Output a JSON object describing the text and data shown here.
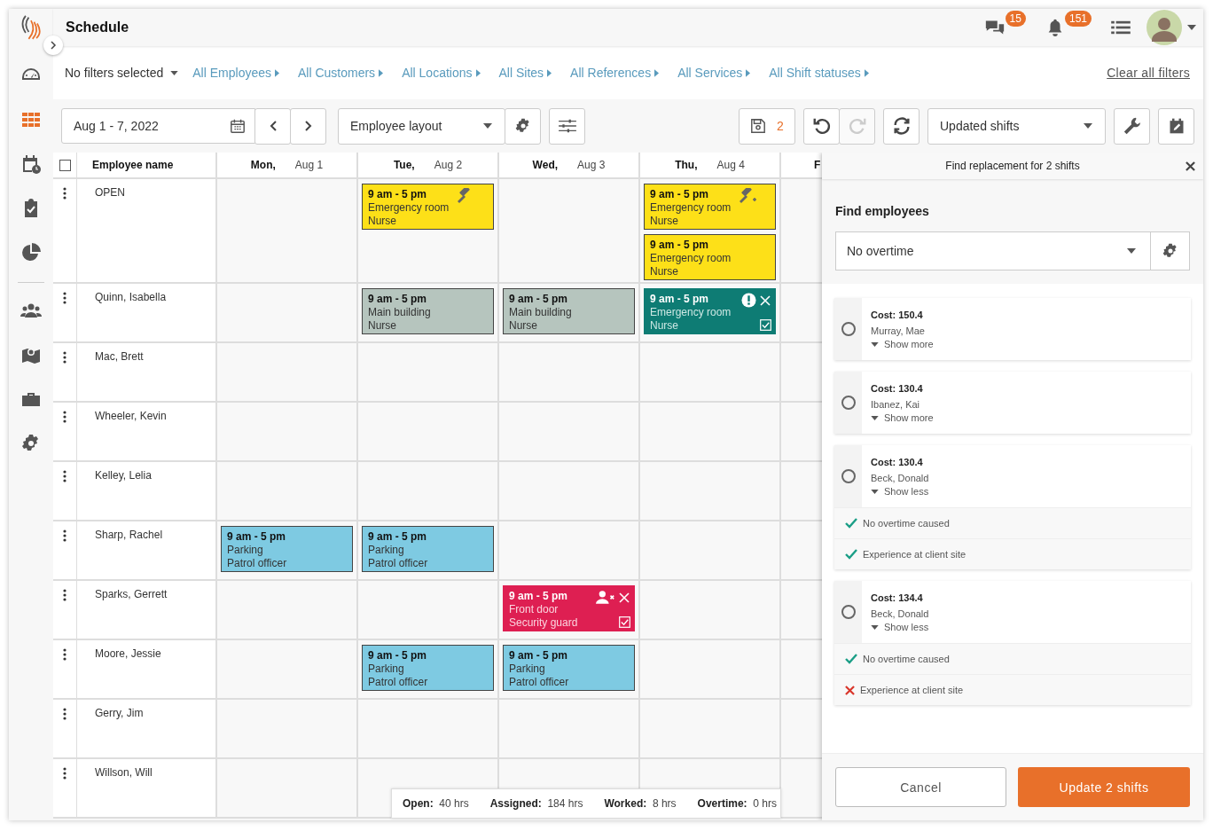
{
  "header": {
    "title": "Schedule",
    "messages_badge": "15",
    "notifications_badge": "151"
  },
  "sidebar": {
    "items": [
      {
        "selected": false
      },
      {
        "selected": true
      },
      {
        "selected": false
      },
      {
        "selected": false
      },
      {
        "selected": false
      },
      {
        "selected": false
      },
      {
        "selected": false
      },
      {
        "selected": false
      },
      {
        "selected": false
      }
    ]
  },
  "filters": {
    "preset": "No filters selected",
    "items": [
      "All Employees",
      "All Customers",
      "All Locations",
      "All Sites",
      "All References",
      "All Services",
      "All Shift statuses"
    ],
    "clear": "Clear all filters"
  },
  "toolbar": {
    "date_range": "Aug 1 - 7, 2022",
    "layout": "Employee layout",
    "unsaved_count": "2",
    "redo_disabled": true,
    "view": "Updated shifts"
  },
  "grid": {
    "select_all_checked": false,
    "name_header": "Employee name",
    "days": [
      {
        "day": "Mon,",
        "date": "Aug 1"
      },
      {
        "day": "Tue,",
        "date": "Aug 2"
      },
      {
        "day": "Wed,",
        "date": "Aug 3"
      },
      {
        "day": "Thu,",
        "date": "Aug 4"
      },
      {
        "day": "F"
      }
    ],
    "rows": [
      {
        "name": "OPEN",
        "cells": [
          [],
          [
            {
              "kind": "open-auction",
              "time": "9 am - 5 pm",
              "location": "Emergency room",
              "role": "Nurse"
            }
          ],
          [],
          [
            {
              "kind": "open-auction-more",
              "time": "9 am - 5 pm",
              "location": "Emergency room",
              "role": "Nurse"
            },
            {
              "kind": "open",
              "time": "9 am - 5 pm",
              "location": "Emergency room",
              "role": "Nurse"
            }
          ]
        ]
      },
      {
        "name": "Quinn, Isabella",
        "cells": [
          [],
          [
            {
              "kind": "assigned",
              "time": "9 am - 5 pm",
              "location": "Main building",
              "role": "Nurse"
            }
          ],
          [
            {
              "kind": "assigned",
              "time": "9 am - 5 pm",
              "location": "Main building",
              "role": "Nurse"
            }
          ],
          [
            {
              "kind": "conflict",
              "time": "9 am - 5 pm",
              "location": "Emergency room",
              "role": "Nurse",
              "checked": true
            }
          ]
        ]
      },
      {
        "name": "Mac, Brett",
        "cells": []
      },
      {
        "name": "Wheeler, Kevin",
        "cells": []
      },
      {
        "name": "Kelley, Lelia",
        "cells": []
      },
      {
        "name": "Sharp, Rachel",
        "cells": [
          [
            {
              "kind": "published",
              "time": "9 am - 5 pm",
              "location": "Parking",
              "role": "Patrol officer"
            }
          ],
          [
            {
              "kind": "published",
              "time": "9 am - 5 pm",
              "location": "Parking",
              "role": "Patrol officer"
            }
          ]
        ]
      },
      {
        "name": "Sparks, Gerrett",
        "cells": [
          [],
          [],
          [
            {
              "kind": "unassigned",
              "time": "9 am - 5 pm",
              "location": "Front door",
              "role": "Security guard",
              "checked": true
            }
          ]
        ]
      },
      {
        "name": "Moore, Jessie",
        "cells": [
          [],
          [
            {
              "kind": "published",
              "time": "9 am - 5 pm",
              "location": "Parking",
              "role": "Patrol officer"
            }
          ],
          [
            {
              "kind": "published",
              "time": "9 am - 5 pm",
              "location": "Parking",
              "role": "Patrol officer"
            }
          ]
        ]
      },
      {
        "name": "Gerry, Jim",
        "cells": []
      },
      {
        "name": "Willson, Will",
        "cells": []
      }
    ]
  },
  "summary": [
    {
      "label": "Open:",
      "value": "40 hrs"
    },
    {
      "label": "Assigned:",
      "value": "184 hrs"
    },
    {
      "label": "Worked:",
      "value": "8 hrs"
    },
    {
      "label": "Overtime:",
      "value": "0 hrs"
    }
  ],
  "panel": {
    "title": "Find replacement for 2 shifts",
    "section": "Find employees",
    "filter": "No overtime",
    "candidates": [
      {
        "cost": "Cost: 150.4",
        "name": "Murray, Mae",
        "toggle": "Show more",
        "selected": false
      },
      {
        "cost": "Cost: 130.4",
        "name": "Ibanez, Kai",
        "toggle": "Show more",
        "selected": false
      },
      {
        "cost": "Cost: 130.4",
        "name": "Beck, Donald",
        "toggle": "Show less",
        "selected": false,
        "criteria": [
          {
            "text": "No overtime caused",
            "met": true
          },
          {
            "text": "Experience at client site",
            "met": true
          }
        ]
      },
      {
        "cost": "Cost: 134.4",
        "name": "Beck, Donald",
        "toggle": "Show less",
        "selected": false,
        "criteria": [
          {
            "text": "No overtime caused",
            "met": true
          },
          {
            "text": "Experience at client site",
            "met": false
          }
        ]
      }
    ],
    "cancel": "Cancel",
    "confirm": "Update 2 shifts"
  }
}
